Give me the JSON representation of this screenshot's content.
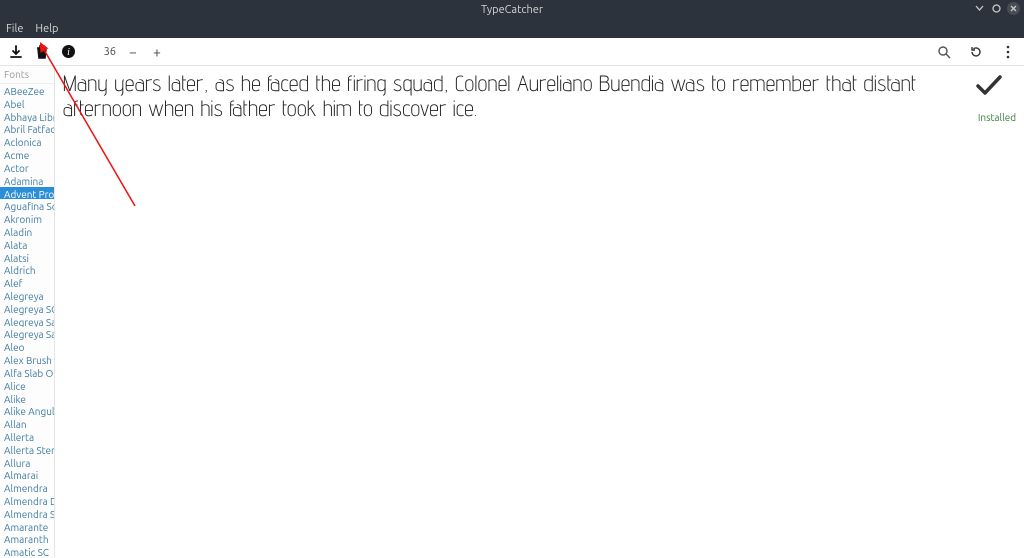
{
  "window": {
    "title": "TypeCatcher"
  },
  "menubar": {
    "file": "File",
    "help": "Help"
  },
  "toolbar": {
    "font_size": "36"
  },
  "sidebar": {
    "header": "Fonts",
    "items": [
      "ABeeZee",
      "Abel",
      "Abhaya Libre",
      "Abril Fatface",
      "Aclonica",
      "Acme",
      "Actor",
      "Adamina",
      "Advent Pro",
      "Aguafina Script",
      "Akronim",
      "Aladin",
      "Alata",
      "Alatsi",
      "Aldrich",
      "Alef",
      "Alegreya",
      "Alegreya SC",
      "Alegreya Sans",
      "Alegreya Sans SC",
      "Aleo",
      "Alex Brush",
      "Alfa Slab One",
      "Alice",
      "Alike",
      "Alike Angular",
      "Allan",
      "Allerta",
      "Allerta Stencil",
      "Allura",
      "Almarai",
      "Almendra",
      "Almendra Display",
      "Almendra SC",
      "Amarante",
      "Amaranth",
      "Amatic SC"
    ],
    "selected_index": 8
  },
  "preview": {
    "text": "Many years later, as he faced the firing squad, Colonel Aureliano Buendia was to remember that distant afternoon when his father took him to discover ice."
  },
  "status": {
    "label": "Installed"
  }
}
